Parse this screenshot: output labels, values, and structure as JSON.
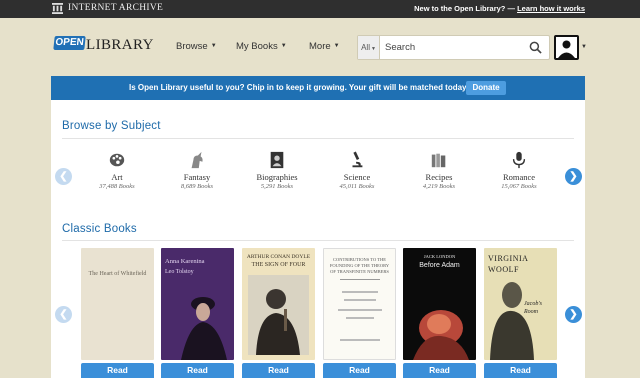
{
  "topbar": {
    "brand": "Internet Archive",
    "new_text": "New to the Open Library? —",
    "learn_link": "Learn how it works"
  },
  "header": {
    "logo_badge": "OPEN",
    "logo_word": "LIBRARY",
    "nav": [
      {
        "label": "Browse"
      },
      {
        "label": "My Books"
      },
      {
        "label": "More"
      }
    ],
    "search_scope": "All",
    "search_placeholder": "Search"
  },
  "banner": {
    "text": "Is Open Library useful to you? Chip in to keep it growing. Your gift will be matched today!",
    "button": "Donate"
  },
  "subjects": {
    "heading": "Browse by Subject",
    "items": [
      {
        "name": "Art",
        "count": "37,488 Books",
        "icon": "palette-icon"
      },
      {
        "name": "Fantasy",
        "count": "8,689 Books",
        "icon": "unicorn-icon"
      },
      {
        "name": "Biographies",
        "count": "5,291 Books",
        "icon": "portrait-icon"
      },
      {
        "name": "Science",
        "count": "45,011 Books",
        "icon": "microscope-icon"
      },
      {
        "name": "Recipes",
        "count": "4,219 Books",
        "icon": "books-icon"
      },
      {
        "name": "Romance",
        "count": "15,067 Books",
        "icon": "microphone-icon"
      }
    ]
  },
  "classics": {
    "heading": "Classic Books",
    "read_label": "Read",
    "books": [
      {
        "title": "The Heart of Whitefield",
        "cover_color": "#e9e2d1",
        "text_color": "#6a6458"
      },
      {
        "title": "Anna Karenina",
        "author": "Leo Tolstoy",
        "cover_color": "#4a2a6a",
        "text_color": "#e4d6f0"
      },
      {
        "title": "The Sign of Four",
        "author": "Arthur Conan Doyle",
        "cover_color": "#efe3bf",
        "text_color": "#3b3326"
      },
      {
        "title": "Contributions to the Founding of the Theory of Transfinite Numbers",
        "cover_color": "#fbfaf4",
        "text_color": "#555"
      },
      {
        "title": "Before Adam",
        "author": "Jack London",
        "cover_color": "#0b0b0b",
        "text_color": "#f0f0f0"
      },
      {
        "title": "Jacob's Room",
        "author": "Virginia Woolf",
        "cover_color": "#e7dfb6",
        "text_color": "#1f1f1f"
      }
    ]
  }
}
